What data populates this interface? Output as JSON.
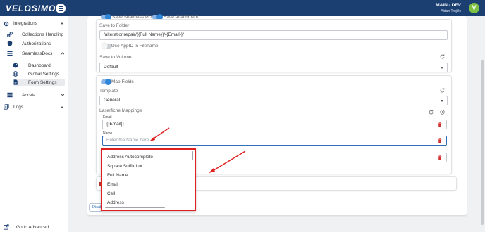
{
  "header": {
    "brand": "VELOSIMO",
    "environment": "MAIN - DEV",
    "user_name": "Aidan Trujillo",
    "avatar_initial": "V"
  },
  "sidebar": {
    "integrations": "Integrations",
    "collections_handling": "Collections Handling",
    "authorizations": "Authorizations",
    "seamlessdocs": "SeamlessDocs",
    "dashboard": "Dashboard",
    "global_settings": "Global Settings",
    "form_settings": "Form Settings",
    "accela": "Accela",
    "logs": "Logs",
    "go_to_advanced": "Go to Advanced"
  },
  "form": {
    "save_seamless_pdf": "Save Seamless PDF",
    "save_attachment": "Save Attachment",
    "save_to_folder_label": "Save to Folder",
    "save_to_folder_value": "/alterationrepair/{{Full Name}}/{{Email}}/",
    "use_appid_label": "Use AppID in Filename",
    "save_to_volume_label": "Save to Volume",
    "save_to_volume_value": "Default",
    "map_fields_label": "Map Fields",
    "template_label": "Template",
    "template_value": "General",
    "laserfiche_mappings_label": "Laserfiche Mappings",
    "email_label": "Email",
    "email_value": "{{Email}}",
    "name_label": "Name",
    "name_placeholder": "Enter the Name here",
    "disable_button": "Disable"
  },
  "dropdown": {
    "options": [
      "Address Autocomplete",
      "Square Suffix Lot",
      "Full Name",
      "Email",
      "Cell",
      "Address"
    ]
  },
  "colors": {
    "header_bg": "#1c3f72",
    "highlight_border": "#e02020",
    "toggle_on": "#2f86d6",
    "trash": "#d32f2f"
  }
}
